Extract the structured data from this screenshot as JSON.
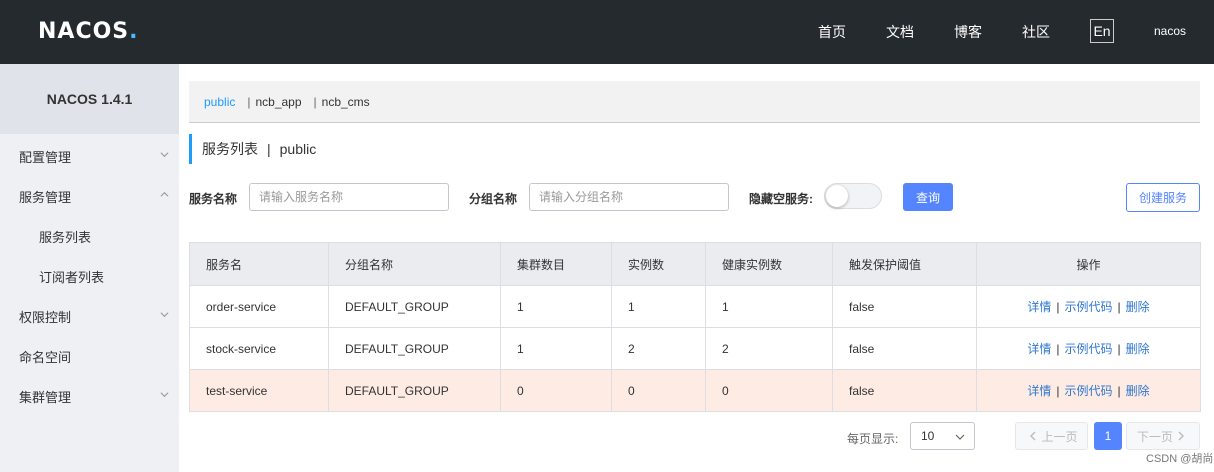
{
  "header": {
    "logo_text": "NACOS",
    "logo_dot": ".",
    "nav": [
      "首页",
      "文档",
      "博客",
      "社区"
    ],
    "lang": "En",
    "user": "nacos"
  },
  "sidebar": {
    "title": "NACOS 1.4.1",
    "items": [
      {
        "label": "配置管理",
        "chevron": "down"
      },
      {
        "label": "服务管理",
        "chevron": "up"
      },
      {
        "label": "服务列表"
      },
      {
        "label": "订阅者列表"
      },
      {
        "label": "权限控制",
        "chevron": "down"
      },
      {
        "label": "命名空间"
      },
      {
        "label": "集群管理",
        "chevron": "down"
      }
    ]
  },
  "namespaces": {
    "items": [
      "public",
      "ncb_app",
      "ncb_cms"
    ],
    "active": "public",
    "separator": "|"
  },
  "page": {
    "title": "服务列表",
    "separator": "|",
    "namespace": "public"
  },
  "filters": {
    "service_name_label": "服务名称",
    "service_name_placeholder": "请输入服务名称",
    "group_name_label": "分组名称",
    "group_name_placeholder": "请输入分组名称",
    "hide_empty_label": "隐藏空服务:",
    "hide_empty_on": false,
    "query_button": "查询",
    "create_button": "创建服务"
  },
  "table": {
    "columns": [
      "服务名",
      "分组名称",
      "集群数目",
      "实例数",
      "健康实例数",
      "触发保护阈值",
      "操作"
    ],
    "rows": [
      {
        "name": "order-service",
        "group": "DEFAULT_GROUP",
        "clusters": "1",
        "instances": "1",
        "healthy": "1",
        "threshold": "false"
      },
      {
        "name": "stock-service",
        "group": "DEFAULT_GROUP",
        "clusters": "1",
        "instances": "2",
        "healthy": "2",
        "threshold": "false"
      },
      {
        "name": "test-service",
        "group": "DEFAULT_GROUP",
        "clusters": "0",
        "instances": "0",
        "healthy": "0",
        "threshold": "false"
      }
    ],
    "actions": {
      "detail": "详情",
      "sample": "示例代码",
      "delete": "删除",
      "separator": "|"
    }
  },
  "pagination": {
    "page_size_label": "每页显示:",
    "page_size": "10",
    "prev": "上一页",
    "current": "1",
    "next": "下一页"
  },
  "watermark": "CSDN @胡尚",
  "colors": {
    "header_bg": "#252a2f",
    "sidebar_bg": "#eef0f4",
    "primary": "#5584ff",
    "link": "#2f77d2",
    "accent": "#209bfa",
    "highlight_row": "#fdebe4"
  }
}
